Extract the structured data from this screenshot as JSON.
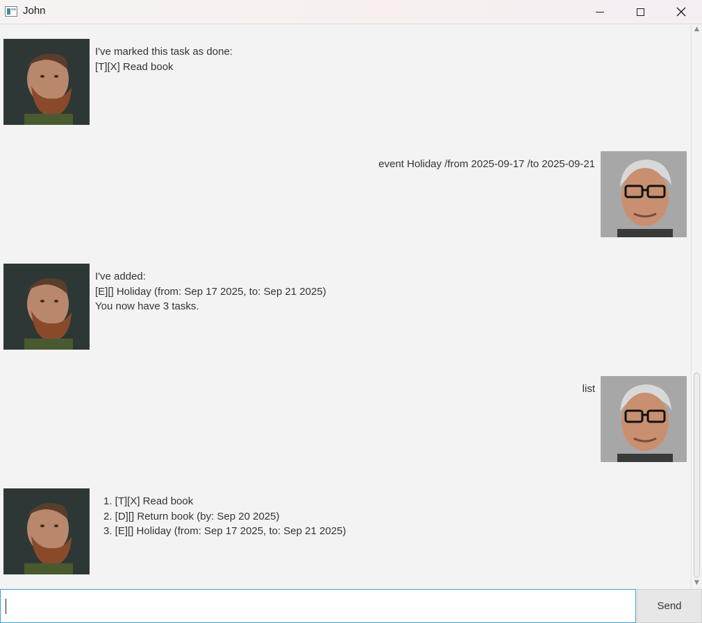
{
  "window": {
    "title": "John"
  },
  "avatars": {
    "bot": "bearded-man-avatar",
    "user": "glasses-man-avatar"
  },
  "messages": [
    {
      "sender": "bot",
      "lines": [
        "I've marked this task as done:",
        "[T][X] Read book"
      ]
    },
    {
      "sender": "user",
      "lines": [
        "event Holiday /from 2025-09-17 /to 2025-09-21"
      ]
    },
    {
      "sender": "bot",
      "lines": [
        "I've added:",
        "[E][] Holiday (from: Sep 17 2025, to: Sep 21 2025)",
        "You now have 3 tasks."
      ]
    },
    {
      "sender": "user",
      "lines": [
        "list"
      ]
    },
    {
      "sender": "bot",
      "lines": [
        "1. [T][X] Read book",
        "2. [D][] Return book (by: Sep 20 2025)",
        "3. [E][] Holiday (from: Sep 17 2025, to: Sep 21 2025)"
      ]
    }
  ],
  "input": {
    "value": "",
    "placeholder": ""
  },
  "send_button": {
    "label": "Send"
  },
  "colors": {
    "background": "#f3f3f3",
    "input_focus_border": "#3c9fd6",
    "send_button_bg": "#e7e7e7"
  }
}
